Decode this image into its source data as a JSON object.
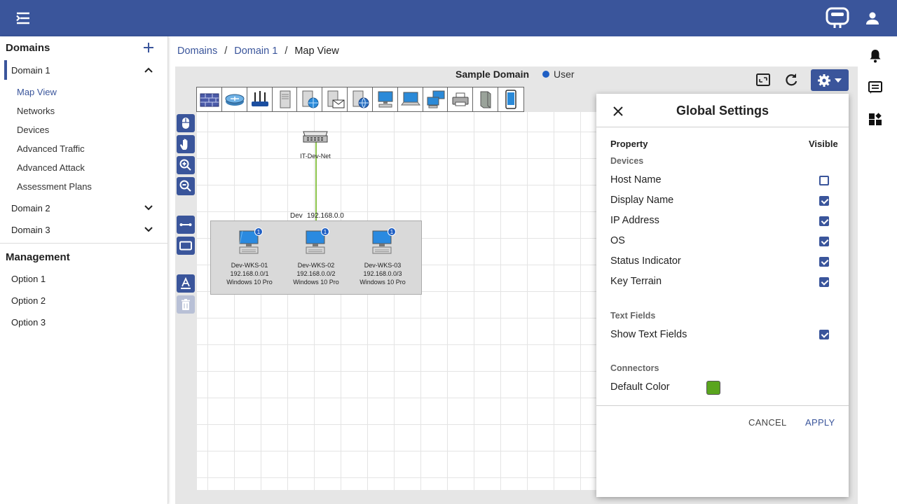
{
  "breadcrumb": {
    "items": [
      "Domains",
      "Domain 1"
    ],
    "current": "Map View"
  },
  "sidebar": {
    "domains_title": "Domains",
    "domain1": {
      "label": "Domain 1",
      "subitems": [
        "Map View",
        "Networks",
        "Devices",
        "Advanced Traffic",
        "Advanced Attack",
        "Assessment Plans"
      ]
    },
    "domain2": "Domain 2",
    "domain3": "Domain 3",
    "management_title": "Management",
    "options": [
      "Option 1",
      "Option 2",
      "Option 3"
    ]
  },
  "map": {
    "title": "Sample Domain",
    "legend_label": "User",
    "legend_color": "#1f5fc4",
    "router_label": "IT-Dev-Net",
    "group_name": "Dev",
    "group_subnet": "192.168.0.0",
    "devices": [
      {
        "name": "Dev-WKS-01",
        "ip": "192.168.0.0/1",
        "os": "Windows 10 Pro",
        "badge": "1"
      },
      {
        "name": "Dev-WKS-02",
        "ip": "192.168.0.0/2",
        "os": "Windows 10 Pro",
        "badge": "1"
      },
      {
        "name": "Dev-WKS-03",
        "ip": "192.168.0.0/3",
        "os": "Windows 10 Pro",
        "badge": "1"
      }
    ],
    "palette": [
      "firewall-icon",
      "router-icon",
      "wireless-router-icon",
      "server-icon",
      "web-server-icon",
      "mail-server-icon",
      "dns-server-icon",
      "workstation-icon",
      "laptop-icon",
      "network-computers-icon",
      "printer-icon",
      "storage-icon",
      "mobile-phone-icon"
    ]
  },
  "settings": {
    "title": "Global Settings",
    "property_header": "Property",
    "visible_header": "Visible",
    "devices_group": "Devices",
    "device_props": [
      {
        "label": "Host Name",
        "checked": false
      },
      {
        "label": "Display Name",
        "checked": true
      },
      {
        "label": "IP Address",
        "checked": true
      },
      {
        "label": "OS",
        "checked": true
      },
      {
        "label": "Status Indicator",
        "checked": true
      },
      {
        "label": "Key Terrain",
        "checked": true
      }
    ],
    "text_fields_group": "Text Fields",
    "show_text_fields": {
      "label": "Show Text Fields",
      "checked": true
    },
    "connectors_group": "Connectors",
    "default_color_label": "Default Color",
    "default_color": "#5aa51e",
    "cancel_label": "CANCEL",
    "apply_label": "APPLY"
  },
  "colors": {
    "primary": "#3a559b",
    "link_line": "#8bc34a"
  }
}
